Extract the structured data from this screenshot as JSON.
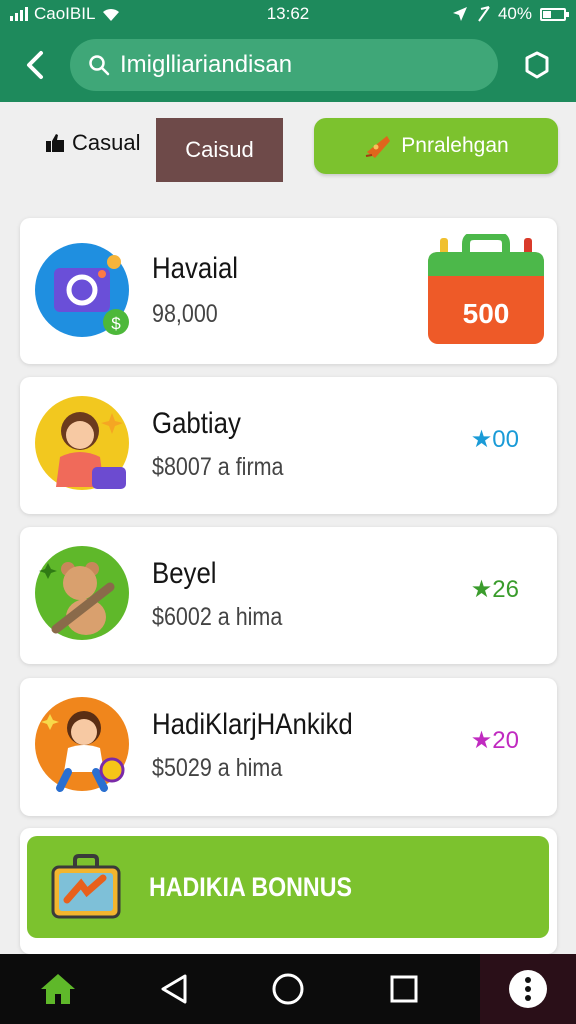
{
  "status_bar": {
    "carrier": "CaoIBIL",
    "time": "13:62",
    "battery": "40%",
    "battery_level": 0.4
  },
  "app_bar": {
    "search_text": "Imiglliariandisan"
  },
  "filters": {
    "casual_label": "Casual",
    "selected_label": "Caisud",
    "promo_label": "Pnralehgan"
  },
  "cards": [
    {
      "title": "Havaial",
      "subtitle": "98,000",
      "badge": "500"
    },
    {
      "title": "Gabtiay",
      "subtitle": "$8007 a firma",
      "rating": "★00"
    },
    {
      "title": "Beyel",
      "subtitle": "$6002 a hima",
      "rating": "★26"
    },
    {
      "title": "HadiKlarjHAnkikd",
      "subtitle": "$5029 a hima",
      "rating": "★20"
    }
  ],
  "bonus": {
    "label": "HADIKIA BONNUS"
  },
  "icons": [
    "signal-icon",
    "wifi-icon",
    "location-icon",
    "battery-icon",
    "back-arrow-icon",
    "search-icon",
    "settings-icon",
    "thumbs-up-icon",
    "promo-icon",
    "camera-app-icon",
    "shopping-bag-icon",
    "girl-avatar-icon",
    "bear-avatar-icon",
    "boy-avatar-icon",
    "briefcase-icon",
    "home-icon",
    "nav-back-icon",
    "nav-home-icon",
    "nav-recents-icon",
    "more-icon"
  ],
  "colors": {
    "brand": "#1e8a5c",
    "accent": "#7cc22e",
    "selected_chip": "#6e4a49",
    "rating_blue": "#1a9bd7",
    "rating_green": "#3a9c2c",
    "rating_magenta": "#c02ac0"
  }
}
